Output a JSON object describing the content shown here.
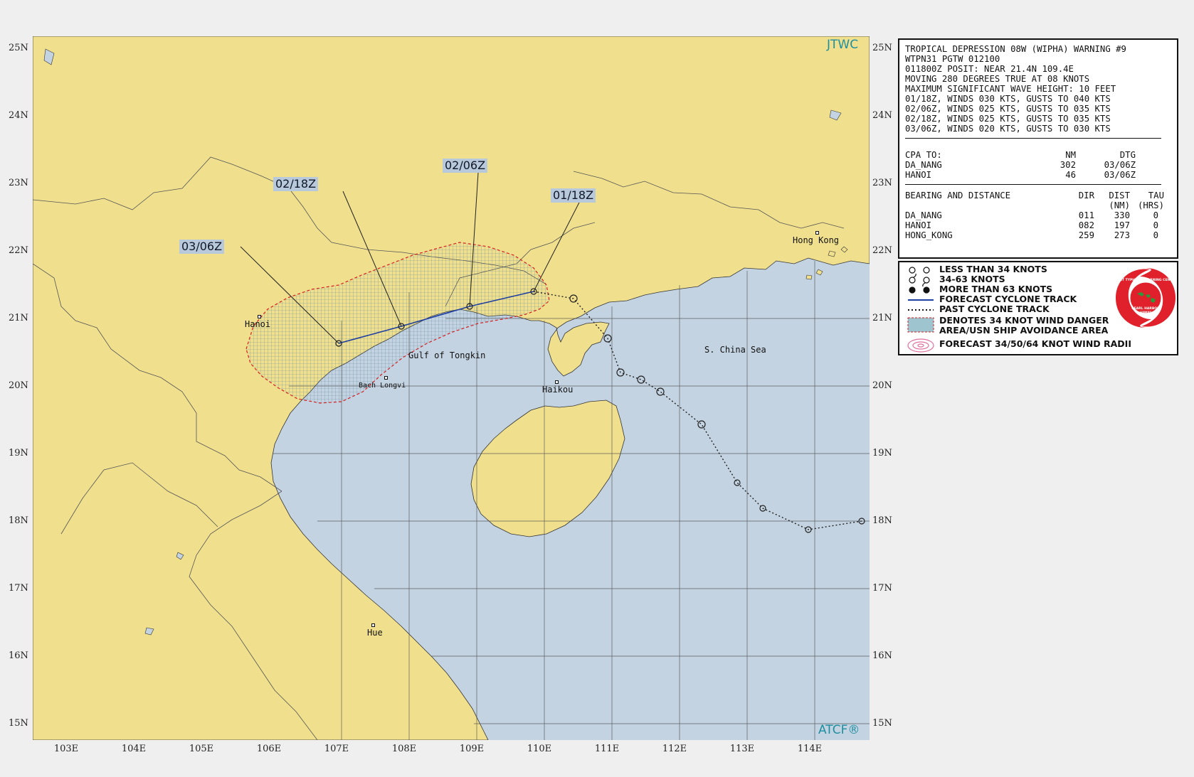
{
  "map": {
    "lat_labels": [
      "25N",
      "24N",
      "23N",
      "22N",
      "21N",
      "20N",
      "19N",
      "18N",
      "17N",
      "16N",
      "15N"
    ],
    "lon_labels": [
      "103E",
      "104E",
      "105E",
      "106E",
      "107E",
      "108E",
      "109E",
      "110E",
      "111E",
      "112E",
      "113E",
      "114E"
    ],
    "places": {
      "hanoi": "Hanoi",
      "gulf": "Gulf of Tongkin",
      "scs": "S. China Sea",
      "haikou": "Haikou",
      "hongkong": "Hong Kong",
      "hue": "Hue",
      "bach": "Bach Longvi"
    },
    "track_labels": {
      "t0118": "01/18Z",
      "t0206": "02/06Z",
      "t0218": "02/18Z",
      "t0306": "03/06Z"
    },
    "brand_top": "JTWC",
    "brand_bottom": "ATCF®",
    "colors": {
      "land": "#f0e08e",
      "sea": "#c4d3e2",
      "danger": "#d42020",
      "grid": "#4a4a4a"
    }
  },
  "info": {
    "title": "TROPICAL DEPRESSION 08W (WIPHA) WARNING #9",
    "line1": "WTPN31 PGTW 012100",
    "line2": "011800Z POSIT: NEAR 21.4N 109.4E",
    "line3": "MOVING 280 DEGREES TRUE AT 08 KNOTS",
    "line4": "MAXIMUM SIGNIFICANT WAVE HEIGHT: 10 FEET",
    "winds": [
      "01/18Z, WINDS 030 KTS, GUSTS TO 040 KTS",
      "02/06Z, WINDS 025 KTS, GUSTS TO 035 KTS",
      "02/18Z, WINDS 025 KTS, GUSTS TO 035 KTS",
      "03/06Z, WINDS 020 KTS, GUSTS TO 030 KTS"
    ],
    "cpa": {
      "header": [
        "CPA TO:",
        "NM",
        "DTG"
      ],
      "rows": [
        [
          "DA_NANG",
          "302",
          "03/06Z"
        ],
        [
          "HANOI",
          "46",
          "03/06Z"
        ]
      ]
    },
    "bearing": {
      "header": [
        "BEARING AND DISTANCE",
        "DIR",
        "DIST",
        "TAU"
      ],
      "subheader": [
        "",
        "",
        "(NM)",
        "(HRS)"
      ],
      "rows": [
        [
          "DA_NANG",
          "011",
          "330",
          "0"
        ],
        [
          "HANOI",
          "082",
          "197",
          "0"
        ],
        [
          "HONG_KONG",
          "259",
          "273",
          "0"
        ]
      ]
    }
  },
  "legend": {
    "items": [
      "LESS THAN 34 KNOTS",
      "34-63 KNOTS",
      "MORE THAN 63 KNOTS",
      "FORECAST CYCLONE TRACK",
      "PAST CYCLONE TRACK",
      "DENOTES 34 KNOT WIND DANGER",
      "AREA/USN SHIP AVOIDANCE AREA",
      "FORECAST 34/50/64 KNOT WIND RADII"
    ],
    "logo": {
      "arc": "JOINT TYPHOON WARNING CENTER",
      "bottom": "PEARL HARBOR",
      "state": "HAWAII"
    }
  }
}
